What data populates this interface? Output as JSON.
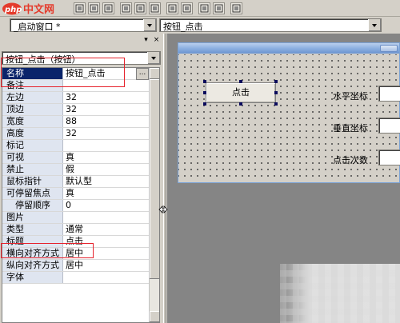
{
  "toolbar": {
    "logo_text_php": "php",
    "logo_text_cn": "中文网",
    "buttons": [
      "align-left-icon",
      "align-center-icon",
      "align-right-icon",
      "align-top-icon",
      "align-middle-icon",
      "align-bottom-icon",
      "same-width-icon",
      "same-height-icon",
      "same-size-icon",
      "center-horizontal-icon",
      "center-vertical-icon"
    ]
  },
  "window_combo": {
    "value": "_启动窗口 *"
  },
  "event_combo": {
    "value": "按钮_点击"
  },
  "property_panel": {
    "header_buttons": [
      "▾",
      "×"
    ],
    "object_combo": {
      "value": "按钮_点击（按钮）"
    },
    "rows": [
      {
        "name": "名称",
        "value": "按钮_点击",
        "selected": true,
        "ellipsis": "..."
      },
      {
        "name": "备注",
        "value": ""
      },
      {
        "name": "左边",
        "value": "32"
      },
      {
        "name": "顶边",
        "value": "32"
      },
      {
        "name": "宽度",
        "value": "88"
      },
      {
        "name": "高度",
        "value": "32"
      },
      {
        "name": "标记",
        "value": ""
      },
      {
        "name": "可视",
        "value": "真"
      },
      {
        "name": "禁止",
        "value": "假"
      },
      {
        "name": "鼠标指针",
        "value": "默认型"
      },
      {
        "name": "可停留焦点",
        "value": "真"
      },
      {
        "name": "　停留顺序",
        "value": "0"
      },
      {
        "name": "图片",
        "value": ""
      },
      {
        "name": "类型",
        "value": "通常"
      },
      {
        "name": "标题",
        "value": "点击"
      },
      {
        "name": "横向对齐方式",
        "value": "居中"
      },
      {
        "name": "纵向对齐方式",
        "value": "居中"
      },
      {
        "name": "字体",
        "value": ""
      }
    ]
  },
  "form_designer": {
    "button_label": "点击",
    "labels": [
      "水平坐标",
      "垂直坐标",
      "点击次数"
    ]
  },
  "colors": {
    "highlight_red": "#e6232d",
    "selection_blue": "#0a246a",
    "canvas_gray": "#858585"
  }
}
